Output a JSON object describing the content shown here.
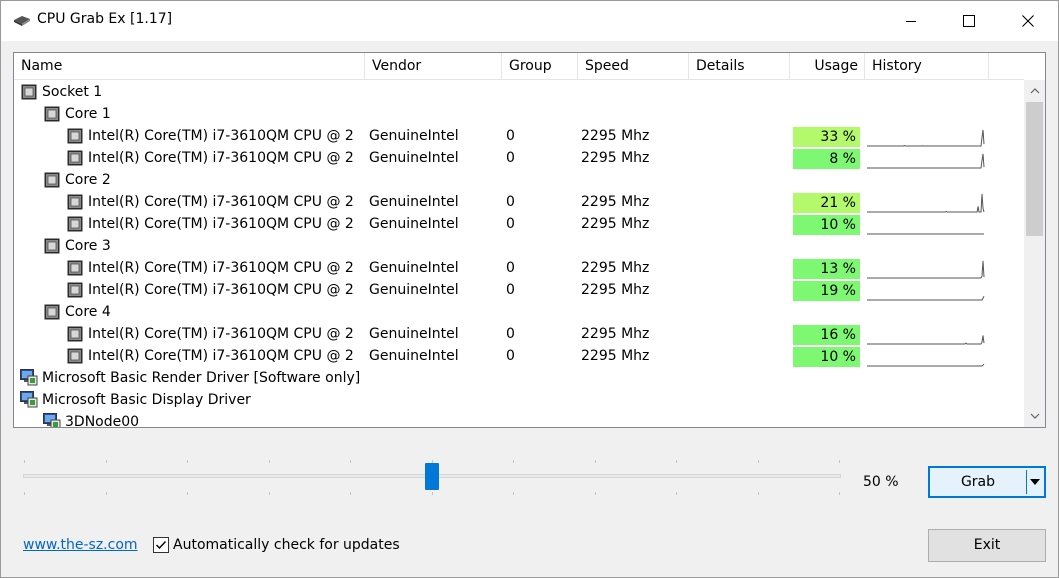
{
  "window": {
    "title": "CPU Grab Ex [1.17]"
  },
  "columns": [
    "Name",
    "Vendor",
    "Group",
    "Speed",
    "Details",
    "Usage",
    "History"
  ],
  "rows": [
    {
      "kind": "socket",
      "level": 0,
      "icon": "cpu-icon",
      "name": "Socket 1"
    },
    {
      "kind": "core",
      "level": 1,
      "icon": "cpu-icon",
      "name": "Core 1"
    },
    {
      "kind": "thread",
      "level": 2,
      "icon": "cpu-icon",
      "name": "Intel(R) Core(TM) i7-3610QM CPU @ 2....",
      "vendor": "GenuineIntel",
      "group": "0",
      "speed": "2295 Mhz",
      "details": "",
      "usage": "33 %",
      "usage_pct": 33,
      "history": [
        0,
        0,
        0,
        0,
        0,
        0,
        0,
        0,
        0,
        0,
        0,
        0,
        0,
        0,
        0,
        0,
        0,
        0,
        0,
        0,
        0,
        0,
        0,
        0,
        0,
        0,
        0,
        0,
        0,
        0,
        0,
        0,
        0,
        0,
        0,
        0,
        0,
        2,
        0,
        0,
        0,
        0,
        0,
        0,
        0,
        0,
        0,
        0,
        0,
        0,
        0,
        0,
        0,
        0,
        0,
        1,
        0,
        0,
        0,
        0,
        0,
        0,
        0,
        0,
        0,
        0,
        0,
        0,
        0,
        0,
        0,
        0,
        0,
        0,
        0,
        0,
        0,
        0,
        0,
        0,
        0,
        0,
        0,
        0,
        0,
        0,
        0,
        0,
        0,
        0,
        0,
        0,
        0,
        0,
        0,
        0,
        0,
        0,
        0,
        0,
        0,
        0,
        0,
        0,
        0,
        0,
        0,
        0,
        0,
        0,
        0,
        0,
        0,
        0,
        45,
        85,
        10
      ]
    },
    {
      "kind": "thread",
      "level": 2,
      "icon": "cpu-icon",
      "name": "Intel(R) Core(TM) i7-3610QM CPU @ 2....",
      "vendor": "GenuineIntel",
      "group": "0",
      "speed": "2295 Mhz",
      "details": "",
      "usage": "8 %",
      "usage_pct": 8,
      "history": [
        0,
        0,
        0,
        0,
        0,
        0,
        0,
        0,
        0,
        0,
        0,
        0,
        0,
        0,
        0,
        0,
        0,
        0,
        0,
        0,
        0,
        0,
        0,
        0,
        0,
        0,
        0,
        0,
        0,
        0,
        0,
        0,
        0,
        0,
        0,
        0,
        0,
        0,
        0,
        0,
        0,
        0,
        0,
        0,
        0,
        0,
        0,
        0,
        0,
        0,
        0,
        0,
        0,
        0,
        0,
        0,
        0,
        0,
        0,
        0,
        0,
        0,
        0,
        0,
        0,
        0,
        0,
        0,
        0,
        0,
        0,
        0,
        0,
        0,
        0,
        0,
        0,
        0,
        0,
        0,
        0,
        0,
        0,
        0,
        0,
        0,
        0,
        0,
        0,
        0,
        0,
        0,
        0,
        0,
        0,
        0,
        0,
        0,
        0,
        0,
        0,
        0,
        0,
        0,
        0,
        0,
        0,
        0,
        0,
        0,
        0,
        0,
        0,
        0,
        40,
        75,
        5
      ]
    },
    {
      "kind": "core",
      "level": 1,
      "icon": "cpu-icon",
      "name": "Core 2"
    },
    {
      "kind": "thread",
      "level": 2,
      "icon": "cpu-icon",
      "name": "Intel(R) Core(TM) i7-3610QM CPU @ 2....",
      "vendor": "GenuineIntel",
      "group": "0",
      "speed": "2295 Mhz",
      "details": "",
      "usage": "21 %",
      "usage_pct": 21,
      "history": [
        0,
        0,
        0,
        0,
        0,
        0,
        0,
        0,
        0,
        0,
        0,
        0,
        0,
        0,
        0,
        0,
        0,
        0,
        0,
        0,
        0,
        0,
        0,
        0,
        0,
        0,
        0,
        0,
        0,
        0,
        0,
        0,
        0,
        0,
        0,
        0,
        0,
        0,
        0,
        0,
        0,
        0,
        0,
        0,
        0,
        0,
        0,
        0,
        0,
        0,
        0,
        0,
        0,
        0,
        0,
        0,
        0,
        0,
        0,
        0,
        0,
        0,
        0,
        0,
        0,
        0,
        0,
        0,
        0,
        0,
        0,
        0,
        0,
        0,
        0,
        0,
        0,
        0,
        0,
        0,
        3,
        0,
        0,
        0,
        0,
        0,
        0,
        0,
        0,
        0,
        0,
        0,
        0,
        0,
        0,
        0,
        0,
        0,
        0,
        0,
        0,
        0,
        0,
        0,
        0,
        0,
        0,
        0,
        0,
        0,
        0,
        0,
        30,
        0,
        0,
        0,
        95,
        20,
        0
      ]
    },
    {
      "kind": "thread",
      "level": 2,
      "icon": "cpu-icon",
      "name": "Intel(R) Core(TM) i7-3610QM CPU @ 2....",
      "vendor": "GenuineIntel",
      "group": "0",
      "speed": "2295 Mhz",
      "details": "",
      "usage": "10 %",
      "usage_pct": 10,
      "history": [
        0,
        0,
        0,
        0,
        0,
        0,
        0,
        0,
        0,
        0,
        0,
        0,
        0,
        0,
        0,
        0,
        0,
        0,
        0,
        0,
        0,
        0,
        0,
        0,
        0,
        0,
        0,
        0,
        0,
        0,
        0,
        0,
        0,
        0,
        0,
        0,
        0,
        0,
        0,
        0,
        0,
        0,
        0,
        0,
        0,
        0,
        0,
        0,
        0,
        0,
        0,
        0,
        0,
        0,
        0,
        0,
        0,
        0,
        0,
        0,
        0,
        0,
        0,
        0,
        0,
        0,
        0,
        0,
        0,
        0,
        0,
        0,
        0,
        0,
        0,
        0,
        0,
        0,
        0,
        0,
        0,
        0,
        0,
        0,
        0,
        0,
        0,
        0,
        0,
        0,
        0,
        0,
        0,
        0,
        0,
        0,
        0,
        0,
        0,
        0,
        0,
        0,
        0,
        0,
        0,
        0,
        0,
        0,
        0,
        0,
        0,
        0,
        0,
        0,
        0,
        0,
        0,
        0,
        0
      ]
    },
    {
      "kind": "core",
      "level": 1,
      "icon": "cpu-icon",
      "name": "Core 3"
    },
    {
      "kind": "thread",
      "level": 2,
      "icon": "cpu-icon",
      "name": "Intel(R) Core(TM) i7-3610QM CPU @ 2....",
      "vendor": "GenuineIntel",
      "group": "0",
      "speed": "2295 Mhz",
      "details": "",
      "usage": "13 %",
      "usage_pct": 13,
      "history": [
        0,
        0,
        0,
        0,
        0,
        0,
        0,
        0,
        0,
        0,
        0,
        0,
        0,
        0,
        0,
        0,
        0,
        0,
        0,
        0,
        0,
        0,
        0,
        0,
        0,
        0,
        0,
        0,
        0,
        0,
        0,
        0,
        0,
        0,
        0,
        0,
        0,
        0,
        0,
        0,
        0,
        0,
        0,
        0,
        0,
        0,
        0,
        0,
        0,
        0,
        0,
        0,
        0,
        0,
        0,
        0,
        0,
        0,
        0,
        0,
        0,
        0,
        0,
        0,
        0,
        0,
        0,
        0,
        0,
        0,
        0,
        0,
        0,
        0,
        0,
        0,
        0,
        0,
        0,
        0,
        0,
        0,
        0,
        0,
        0,
        0,
        0,
        0,
        0,
        0,
        0,
        0,
        0,
        0,
        0,
        0,
        0,
        0,
        0,
        0,
        0,
        0,
        0,
        0,
        0,
        0,
        0,
        0,
        0,
        0,
        0,
        0,
        0,
        0,
        10,
        90,
        5
      ]
    },
    {
      "kind": "thread",
      "level": 2,
      "icon": "cpu-icon",
      "name": "Intel(R) Core(TM) i7-3610QM CPU @ 2....",
      "vendor": "GenuineIntel",
      "group": "0",
      "speed": "2295 Mhz",
      "details": "",
      "usage": "19 %",
      "usage_pct": 19,
      "history": [
        0,
        0,
        0,
        0,
        0,
        0,
        0,
        0,
        0,
        0,
        0,
        0,
        0,
        0,
        0,
        0,
        0,
        0,
        0,
        0,
        0,
        0,
        0,
        0,
        0,
        0,
        0,
        0,
        0,
        0,
        0,
        0,
        0,
        0,
        0,
        0,
        0,
        0,
        0,
        0,
        0,
        0,
        0,
        0,
        0,
        0,
        0,
        0,
        0,
        0,
        0,
        0,
        0,
        0,
        0,
        0,
        0,
        0,
        0,
        0,
        0,
        0,
        0,
        0,
        0,
        0,
        0,
        0,
        0,
        0,
        0,
        0,
        0,
        0,
        0,
        0,
        0,
        0,
        0,
        0,
        0,
        0,
        0,
        0,
        0,
        0,
        0,
        0,
        0,
        0,
        0,
        0,
        0,
        0,
        0,
        0,
        0,
        0,
        0,
        0,
        0,
        0,
        0,
        0,
        0,
        0,
        0,
        0,
        0,
        0,
        0,
        0,
        0,
        0,
        0,
        10,
        20
      ]
    },
    {
      "kind": "core",
      "level": 1,
      "icon": "cpu-icon",
      "name": "Core 4"
    },
    {
      "kind": "thread",
      "level": 2,
      "icon": "cpu-icon",
      "name": "Intel(R) Core(TM) i7-3610QM CPU @ 2....",
      "vendor": "GenuineIntel",
      "group": "0",
      "speed": "2295 Mhz",
      "details": "",
      "usage": "16 %",
      "usage_pct": 16,
      "history": [
        0,
        0,
        0,
        0,
        0,
        0,
        0,
        0,
        0,
        0,
        0,
        0,
        0,
        0,
        0,
        0,
        0,
        0,
        0,
        0,
        0,
        0,
        0,
        0,
        0,
        0,
        0,
        0,
        0,
        0,
        0,
        0,
        0,
        0,
        0,
        0,
        0,
        0,
        0,
        0,
        0,
        0,
        0,
        0,
        0,
        0,
        0,
        0,
        0,
        0,
        0,
        0,
        0,
        0,
        0,
        0,
        0,
        0,
        0,
        0,
        0,
        0,
        0,
        0,
        0,
        0,
        0,
        0,
        0,
        0,
        0,
        0,
        0,
        0,
        0,
        0,
        0,
        0,
        0,
        0,
        0,
        0,
        0,
        0,
        0,
        0,
        0,
        0,
        0,
        0,
        0,
        0,
        0,
        0,
        0,
        0,
        0,
        0,
        5,
        0,
        0,
        0,
        0,
        0,
        0,
        0,
        0,
        0,
        0,
        0,
        0,
        0,
        0,
        0,
        10,
        45,
        5
      ]
    },
    {
      "kind": "thread",
      "level": 2,
      "icon": "cpu-icon",
      "name": "Intel(R) Core(TM) i7-3610QM CPU @ 2....",
      "vendor": "GenuineIntel",
      "group": "0",
      "speed": "2295 Mhz",
      "details": "",
      "usage": "10 %",
      "usage_pct": 10,
      "history": [
        0,
        0,
        0,
        0,
        0,
        0,
        0,
        0,
        0,
        0,
        0,
        0,
        0,
        0,
        0,
        0,
        0,
        0,
        0,
        0,
        0,
        0,
        0,
        0,
        0,
        0,
        0,
        0,
        0,
        0,
        0,
        0,
        0,
        0,
        0,
        0,
        0,
        0,
        0,
        0,
        0,
        0,
        0,
        0,
        0,
        0,
        0,
        0,
        0,
        0,
        0,
        0,
        0,
        0,
        0,
        0,
        0,
        0,
        0,
        0,
        0,
        0,
        0,
        0,
        0,
        0,
        0,
        0,
        0,
        0,
        0,
        0,
        0,
        0,
        0,
        0,
        0,
        0,
        0,
        0,
        0,
        0,
        0,
        0,
        0,
        0,
        0,
        0,
        0,
        0,
        0,
        0,
        0,
        0,
        0,
        0,
        0,
        0,
        0,
        0,
        0,
        0,
        0,
        0,
        0,
        0,
        0,
        0,
        0,
        0,
        0,
        0,
        0,
        0,
        0,
        5,
        10
      ]
    },
    {
      "kind": "gpu",
      "level": 0,
      "icon": "monitor-icon",
      "name": "Microsoft Basic Render Driver [Software only]"
    },
    {
      "kind": "gpu",
      "level": 0,
      "icon": "monitor-icon",
      "name": "Microsoft Basic Display Driver"
    },
    {
      "kind": "node",
      "level": 1,
      "icon": "monitor-icon",
      "name": "3DNode00"
    }
  ],
  "slider": {
    "value_label": "50 %",
    "fraction": 0.5
  },
  "buttons": {
    "grab": "Grab",
    "exit": "Exit"
  },
  "footer": {
    "link": "www.the-sz.com",
    "auto_update_label": "Automatically check for updates",
    "auto_update_checked": true
  },
  "colors": {
    "usage_high": "#b4f96c",
    "usage_low": "#7ef772",
    "selection": "#0078d7",
    "link": "#0066cc"
  }
}
